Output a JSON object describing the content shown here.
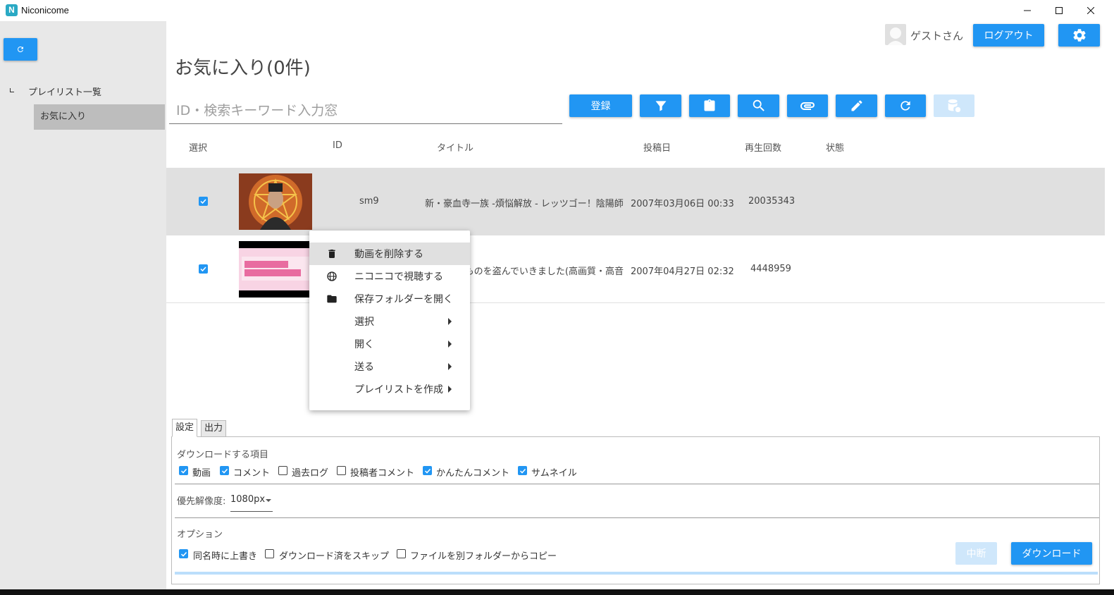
{
  "window": {
    "title": "Niconicome",
    "logo_letter": "N"
  },
  "sidebar": {
    "tree_root": "プレイリスト一覧",
    "tree_child": "お気に入り"
  },
  "header": {
    "user_name": "ゲストさん",
    "logout_label": "ログアウト",
    "page_title": "お気に入り(0件)"
  },
  "search": {
    "placeholder": "ID・検索キーワード入力窓"
  },
  "toolbar": {
    "register_label": "登録"
  },
  "table": {
    "headers": [
      "選択",
      "ID",
      "タイトル",
      "投稿日",
      "再生回数",
      "状態"
    ],
    "rows": [
      {
        "selected": true,
        "id": "sm9",
        "title": "新・豪血寺一族 -煩悩解放 - レッツゴー！陰陽師",
        "date": "2007年03月06日 00:33",
        "views": "20035343",
        "status": ""
      },
      {
        "selected": true,
        "id": "",
        "title": "ものを盗んでいきました(高画質・高音",
        "date": "2007年04月27日 02:32",
        "views": "4448959",
        "status": ""
      }
    ]
  },
  "context_menu": {
    "items": [
      {
        "label": "動画を削除する",
        "icon": "trash-icon"
      },
      {
        "label": "ニコニコで視聴する",
        "icon": "globe-icon"
      },
      {
        "label": "保存フォルダーを開く",
        "icon": "folder-icon"
      },
      {
        "label": "選択",
        "submenu": true
      },
      {
        "label": "開く",
        "submenu": true
      },
      {
        "label": "送る",
        "submenu": true
      },
      {
        "label": "プレイリストを作成",
        "submenu": true
      }
    ]
  },
  "settings": {
    "tabs": [
      "設定",
      "出力"
    ],
    "download_items_label": "ダウンロードする項目",
    "download_items": [
      {
        "label": "動画",
        "checked": true
      },
      {
        "label": "コメント",
        "checked": true
      },
      {
        "label": "過去ログ",
        "checked": false
      },
      {
        "label": "投稿者コメント",
        "checked": false
      },
      {
        "label": "かんたんコメント",
        "checked": true
      },
      {
        "label": "サムネイル",
        "checked": true
      }
    ],
    "resolution_label": "優先解像度:",
    "resolution_value": "1080px",
    "options_label": "オプション",
    "options": [
      {
        "label": "同名時に上書き",
        "checked": true
      },
      {
        "label": "ダウンロード済をスキップ",
        "checked": false
      },
      {
        "label": "ファイルを別フォルダーからコピー",
        "checked": false
      }
    ],
    "cancel_label": "中断",
    "download_label": "ダウンロード"
  },
  "colors": {
    "accent": "#2196f3",
    "sidebar_bg": "#e8e8e8",
    "selected_row": "#e0e0e0"
  }
}
